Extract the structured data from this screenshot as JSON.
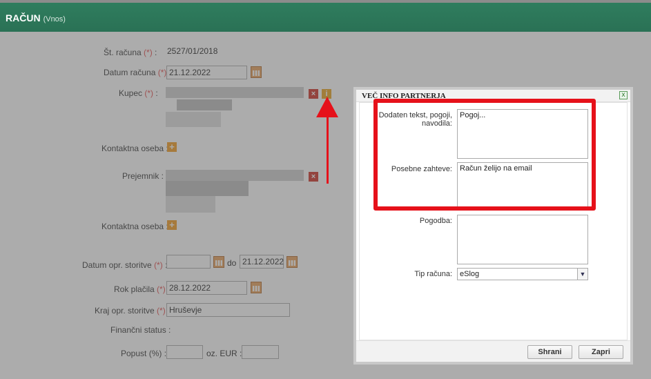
{
  "header": {
    "title": "RAČUN",
    "subtitle": "(Vnos)"
  },
  "form": {
    "st_racuna": {
      "label": "Št. računa",
      "req": "(*)",
      "value": "2527/01/2018"
    },
    "datum_racuna": {
      "label": "Datum računa",
      "req": "(*)",
      "value": "21.12.2022"
    },
    "kupec": {
      "label": "Kupec",
      "req": "(*)"
    },
    "kontaktna_oseba_1": {
      "label": "Kontaktna oseba :"
    },
    "prejemnik": {
      "label": "Prejemnik :"
    },
    "kontaktna_oseba_2": {
      "label": "Kontaktna oseba :"
    },
    "datum_opr": {
      "label": "Datum opr. storitve",
      "req": "(*)",
      "from": "",
      "do_label": "do",
      "to": "21.12.2022"
    },
    "rok_placila": {
      "label": "Rok plačila",
      "req": "(*)",
      "value": "28.12.2022"
    },
    "kraj_opr": {
      "label": "Kraj opr. storitve",
      "req": "(*)",
      "value": "Hruševje"
    },
    "financni_status": {
      "label": "Finančni status :"
    },
    "popust": {
      "label": "Popust (%) :",
      "value": "",
      "eur_label": "oz. EUR :",
      "eur_value": ""
    }
  },
  "dialog": {
    "title": "VEČ INFO PARTNERJA",
    "close": "x",
    "dodaten_label": "Dodaten tekst, pogoji, navodila:",
    "dodaten_value": "Pogoj...",
    "posebne_label": "Posebne zahteve:",
    "posebne_value": "Račun želijo na email",
    "pogodba_label": "Pogodba:",
    "pogodba_value": "",
    "tip_label": "Tip računa:",
    "tip_value": "eSlog",
    "save_label": "Shrani",
    "close_label": "Zapri"
  },
  "colors": {
    "header": "#2f7d5e",
    "highlight": "#e6111a",
    "required": "#e24a4a"
  }
}
